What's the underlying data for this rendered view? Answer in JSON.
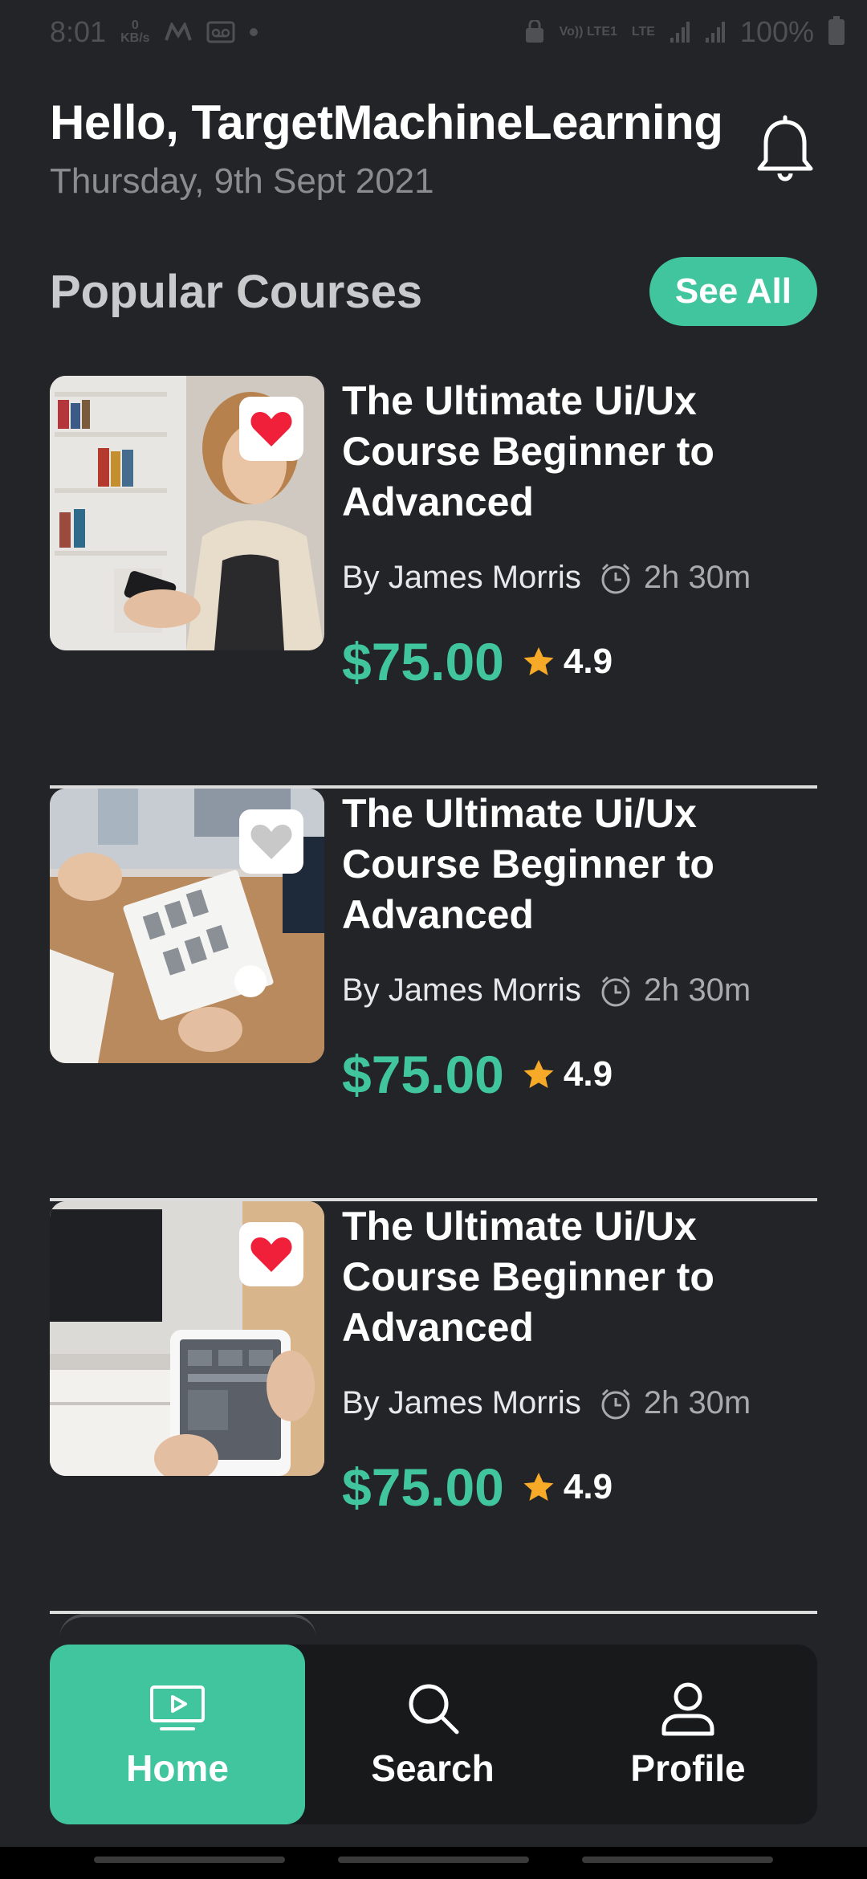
{
  "status_bar": {
    "time": "8:01",
    "net_speed_value": "0",
    "net_speed_unit": "KB/s",
    "volte_label": "Vo)) LTE1",
    "lte_label": "LTE",
    "battery": "100%"
  },
  "header": {
    "greeting": "Hello, TargetMachineLearning",
    "date": "Thursday, 9th Sept 2021"
  },
  "section": {
    "title": "Popular Courses",
    "see_all_label": "See All"
  },
  "courses": [
    {
      "title": "The Ultimate Ui/Ux Course Beginner to Advanced",
      "author": "By James Morris",
      "duration": "2h 30m",
      "price": "$75.00",
      "rating": "4.9",
      "favorited": true
    },
    {
      "title": "The Ultimate Ui/Ux Course Beginner to Advanced",
      "author": "By James Morris",
      "duration": "2h 30m",
      "price": "$75.00",
      "rating": "4.9",
      "favorited": false
    },
    {
      "title": "The Ultimate Ui/Ux Course Beginner to Advanced",
      "author": "By James Morris",
      "duration": "2h 30m",
      "price": "$75.00",
      "rating": "4.9",
      "favorited": true
    }
  ],
  "nav": {
    "items": [
      {
        "label": "Home",
        "icon": "play-screen-icon",
        "active": true
      },
      {
        "label": "Search",
        "icon": "search-icon",
        "active": false
      },
      {
        "label": "Profile",
        "icon": "user-icon",
        "active": false
      }
    ]
  },
  "colors": {
    "background": "#232427",
    "accent": "#41c59e",
    "heart": "#f0203a",
    "heart_inactive": "#c8c8c8",
    "star": "#f7a928",
    "nav_background": "#18191b"
  }
}
